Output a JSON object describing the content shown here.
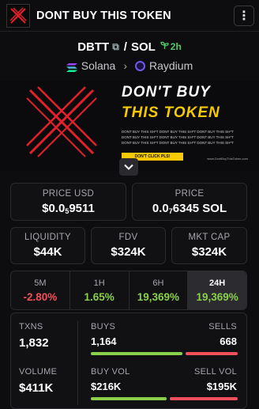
{
  "header": {
    "title": "DONT BUY THIS TOKEN",
    "menu_icon": "more-vertical-icon"
  },
  "pair": {
    "base": "DBTT",
    "quote": "SOL",
    "age": "2h",
    "age_icon": "seedling-icon",
    "copy_icon": "copy-icon"
  },
  "chain": {
    "network": "Solana",
    "dex": "Raydium"
  },
  "banner": {
    "line1": "DON'T BUY",
    "line2": "THIS TOKEN",
    "fine_print": "DONT BUY THIS SH*T DONT BUY THIS SH*T DONT BUY THIS SH*T",
    "button": "DON'T CLICK PLS!",
    "site": "www.DontBuyThisToken.com",
    "colors": {
      "x": "#e4202a",
      "accent": "#f7c900"
    }
  },
  "price": {
    "usd_label": "PRICE USD",
    "usd_prefix": "$0.0",
    "usd_zeros": "5",
    "usd_suffix": "9511",
    "sol_label": "PRICE",
    "sol_prefix": "0.0",
    "sol_zeros": "7",
    "sol_suffix": "6345 SOL"
  },
  "metrics": {
    "liquidity_label": "LIQUIDITY",
    "liquidity": "$44K",
    "fdv_label": "FDV",
    "fdv": "$324K",
    "mcap_label": "MKT CAP",
    "mcap": "$324K"
  },
  "timeframes": [
    {
      "label": "5M",
      "value": "-2.80%",
      "trend": "down"
    },
    {
      "label": "1H",
      "value": "1.65%",
      "trend": "up"
    },
    {
      "label": "6H",
      "value": "19,369%",
      "trend": "up"
    },
    {
      "label": "24H",
      "value": "19,369%",
      "trend": "up",
      "active": true
    }
  ],
  "stats": {
    "txns_label": "TXNS",
    "txns": "1,832",
    "buys_label": "BUYS",
    "buys": "1,164",
    "sells_label": "SELLS",
    "sells": "668",
    "volume_label": "VOLUME",
    "volume": "$411K",
    "buy_vol_label": "BUY VOL",
    "buy_vol": "$216K",
    "sell_vol_label": "SELL VOL",
    "sell_vol": "$195K",
    "buy_share": 0.635,
    "buy_vol_share": 0.526,
    "colors": {
      "buy": "#8ad04a",
      "sell": "#f0505a"
    }
  }
}
